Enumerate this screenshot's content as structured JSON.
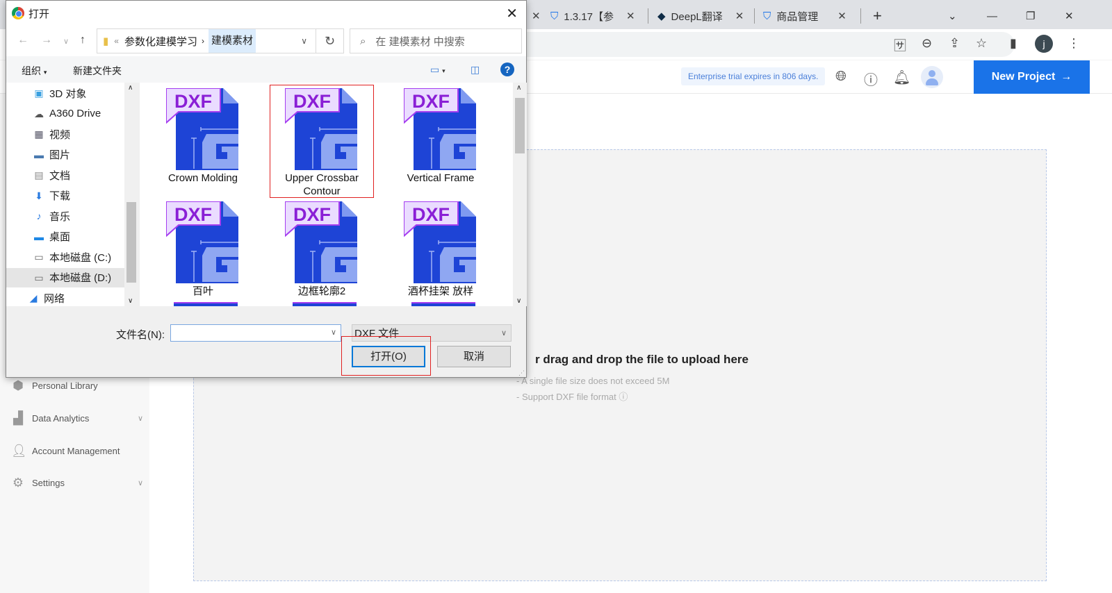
{
  "browser": {
    "tabs": [
      {
        "label": "1.3.17【参",
        "close": "✕"
      },
      {
        "label": "DeepL翻译",
        "close": "✕"
      },
      {
        "label": "商品管理",
        "close": "✕"
      }
    ],
    "new_tab": "+",
    "profile_initial": "j"
  },
  "app": {
    "trial_text": "Enterprise trial expires in 806 days.",
    "new_project": "New Project",
    "sidebar": [
      {
        "label": "Personal Library",
        "icon": "cube-icon",
        "chevron": false
      },
      {
        "label": "Data Analytics",
        "icon": "bar-chart-icon",
        "chevron": true
      },
      {
        "label": "Account Management",
        "icon": "user-icon",
        "chevron": false
      },
      {
        "label": "Settings",
        "icon": "gear-icon",
        "chevron": true
      }
    ],
    "upload": {
      "title": "r drag and drop the file to upload here",
      "notes": [
        "- A single file size does not exceed 5M",
        "- Support DXF file format"
      ]
    }
  },
  "dialog": {
    "title": "打开",
    "breadcrumb": {
      "prefix": "«",
      "parent": "参数化建模学习",
      "current": "建模素材"
    },
    "search_placeholder": "在 建模素材 中搜索",
    "organize": "组织",
    "new_folder": "新建文件夹",
    "tree": [
      "3D 对象",
      "A360 Drive",
      "视频",
      "图片",
      "文档",
      "下载",
      "音乐",
      "桌面",
      "本地磁盘 (C:)",
      "本地磁盘 (D:)",
      "网络"
    ],
    "tree_selected": 9,
    "files": [
      {
        "name": "Crown Molding",
        "badge": "DXF"
      },
      {
        "name": "Upper Crossbar Contour",
        "badge": "DXF"
      },
      {
        "name": "Vertical Frame",
        "badge": "DXF"
      },
      {
        "name": "百叶",
        "badge": "DXF"
      },
      {
        "name": "边框轮廓2",
        "badge": "DXF"
      },
      {
        "name": "酒杯挂架 放样",
        "badge": "DXF"
      }
    ],
    "selected_file": 1,
    "filename_label": "文件名(N):",
    "filename_value": "",
    "filetype": "DXF 文件",
    "open_button": "打开(O)",
    "cancel_button": "取消"
  }
}
